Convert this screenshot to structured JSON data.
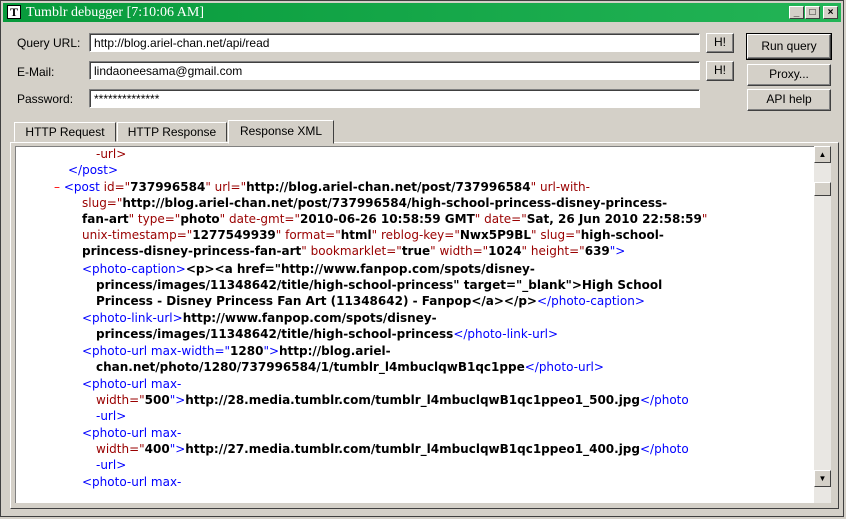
{
  "window": {
    "title": "Tumblr debugger [7:10:06 AM]",
    "icon_letter": "T",
    "minimize_glyph": "_",
    "maximize_glyph": "□",
    "close_glyph": "×"
  },
  "form": {
    "query_url_label": "Query URL:",
    "query_url_value": "http://blog.ariel-chan.net/api/read",
    "email_label": "E-Mail:",
    "email_value": "lindaoneesama@gmail.com",
    "password_label": "Password:",
    "password_value": "**************",
    "h_button_label": "H!"
  },
  "buttons": {
    "run_query": "Run query",
    "proxy": "Proxy...",
    "api_help": "API help"
  },
  "tabs": [
    {
      "label": "HTTP Request"
    },
    {
      "label": "HTTP Response"
    },
    {
      "label": "Response XML",
      "active": true
    }
  ],
  "xml": {
    "minus_sign": "–",
    "l0": "-url>",
    "l1": "</post>",
    "l2a": "<post ",
    "l2b": "id=\"",
    "l2c": "737996584",
    "l2d": "\" url=\"",
    "l2e": "http://blog.ariel-chan.net/post/737996584",
    "l2f": "\" url-with-",
    "l3a": "slug=\"",
    "l3b": "http://blog.ariel-chan.net/post/737996584/high-school-princess-disney-princess-",
    "l4a": "fan-art",
    "l4b": "\" type=\"",
    "l4c": "photo",
    "l4d": "\" date-gmt=\"",
    "l4e": "2010-06-26 10:58:59 GMT",
    "l4f": "\" date=\"",
    "l4g": "Sat, 26 Jun 2010 22:58:59",
    "l4h": "\"",
    "l5a": "unix-timestamp=\"",
    "l5b": "1277549939",
    "l5c": "\" format=\"",
    "l5d": "html",
    "l5e": "\" reblog-key=\"",
    "l5f": "Nwx5P9BL",
    "l5g": "\" slug=\"",
    "l5h": "high-school-",
    "l6a": "princess-disney-princess-fan-art",
    "l6b": "\" bookmarklet=\"",
    "l6c": "true",
    "l6d": "\" width=\"",
    "l6e": "1024",
    "l6f": "\" height=\"",
    "l6g": "639",
    "l6h": "\">",
    "l7a": "<photo-caption>",
    "l7b": "<p><a href=\"http://www.fanpop.com/spots/disney-",
    "l8": "princess/images/11348642/title/high-school-princess\" target=\"_blank\">High School",
    "l9a": "Princess - Disney Princess Fan Art (11348642) - Fanpop</a></p>",
    "l9b": "</photo-caption>",
    "l10a": "<photo-link-url>",
    "l10b": "http://www.fanpop.com/spots/disney-",
    "l11a": "princess/images/11348642/title/high-school-princess",
    "l11b": "</photo-link-url>",
    "l12a": "<photo-url max-width=\"",
    "l12b": "1280",
    "l12c": "\">",
    "l12d": "http://blog.ariel-",
    "l13a": "chan.net/photo/1280/737996584/1/tumblr_l4mbuclqwB1qc1ppe",
    "l13b": "</photo-url>",
    "l14": "<photo-url max-",
    "l15a": "width=\"",
    "l15b": "500",
    "l15c": "\">",
    "l15d": "http://28.media.tumblr.com/tumblr_l4mbuclqwB1qc1ppeo1_500.jpg",
    "l15e": "</photo",
    "l16": "-url>",
    "l17": "<photo-url max-",
    "l18a": "width=\"",
    "l18b": "400",
    "l18c": "\">",
    "l18d": "http://27.media.tumblr.com/tumblr_l4mbuclqwB1qc1ppeo1_400.jpg",
    "l18e": "</photo",
    "l19": "-url>",
    "l20": "<photo-url max-"
  },
  "scrollbar": {
    "up_glyph": "▲",
    "down_glyph": "▼"
  }
}
